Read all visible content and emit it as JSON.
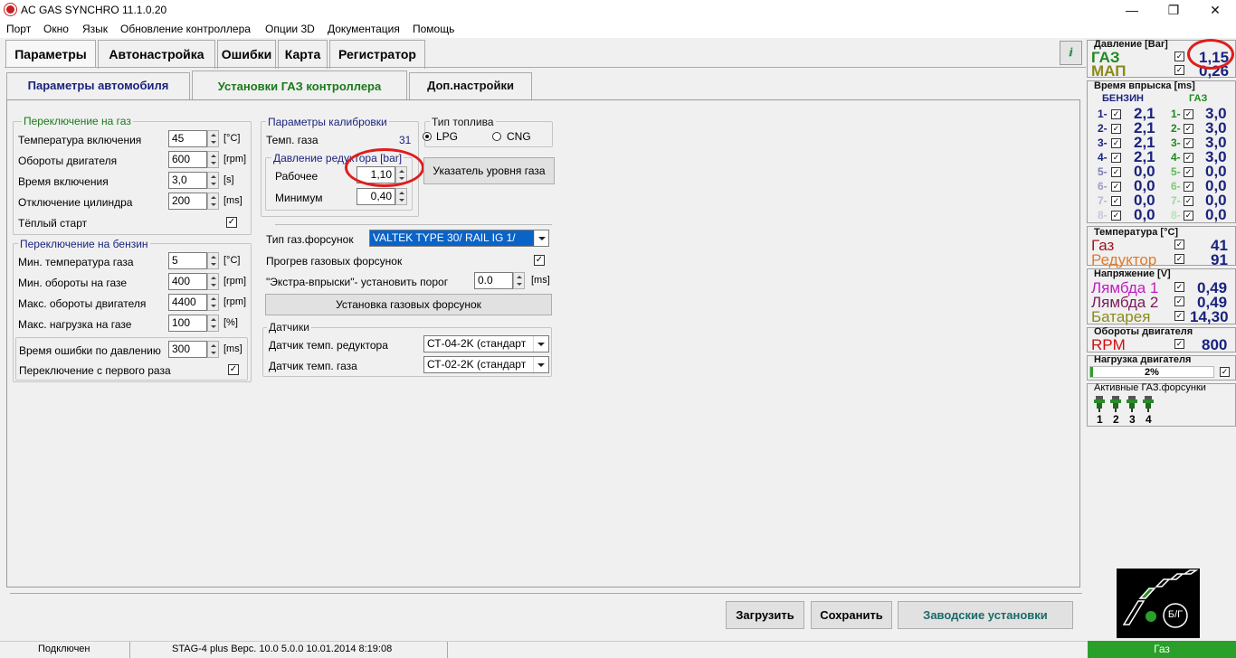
{
  "window": {
    "title": "AC GAS SYNCHRO  11.1.0.20",
    "minimize": "—",
    "maximize": "❐",
    "close": "✕"
  },
  "menu": [
    "Порт",
    "Окно",
    "Язык",
    "Обновление контроллера",
    "Опции 3D",
    "Документация",
    "Помощь"
  ],
  "tabs": [
    "Параметры",
    "Автонастройка",
    "Ошибки",
    "Карта",
    "Регистратор"
  ],
  "subtabs": [
    "Параметры автомобиля",
    "Установки ГАЗ контроллера",
    "Доп.настройки"
  ],
  "switch_gas": {
    "title": "Переключение на газ",
    "rows": [
      {
        "label": "Температура включения",
        "value": "45",
        "unit": "[°C]"
      },
      {
        "label": "Обороты двигателя",
        "value": "600",
        "unit": "[rpm]"
      },
      {
        "label": "Время включения",
        "value": "3,0",
        "unit": "[s]"
      },
      {
        "label": "Отключение цилиндра",
        "value": "200",
        "unit": "[ms]"
      }
    ],
    "warm_start": "Тёплый старт"
  },
  "switch_petrol": {
    "title": "Переключение на бензин",
    "rows": [
      {
        "label": "Мин. температура газа",
        "value": "5",
        "unit": "[°C]"
      },
      {
        "label": "Мин. обороты на газе",
        "value": "400",
        "unit": "[rpm]"
      },
      {
        "label": "Макс. обороты двигателя",
        "value": "4400",
        "unit": "[rpm]"
      },
      {
        "label": "Макс. нагрузка на газе",
        "value": "100",
        "unit": "[%]"
      }
    ],
    "err_time_label": "Время ошибки по давлению",
    "err_time_value": "300",
    "err_time_unit": "[ms]",
    "first_switch": "Переключение с первого раза"
  },
  "calib": {
    "title": "Параметры калибровки",
    "gas_temp_label": "Темп. газа",
    "gas_temp_value": "31",
    "pressure_title": "Давление редуктора [bar]",
    "work_label": "Рабочее",
    "work_value": "1,10",
    "min_label": "Минимум",
    "min_value": "0,40"
  },
  "fuel": {
    "title": "Тип топлива",
    "lpg": "LPG",
    "cng": "CNG"
  },
  "gauge_button": "Указатель уровня газа",
  "injector": {
    "type_label": "Тип газ.форсунок",
    "type_value": "VALTEK TYPE 30/ RAIL IG 1/",
    "heat_label": "Прогрев газовых форсунок",
    "extra_label": "\"Экстра-впрыски\"- установить порог",
    "extra_value": "0.0",
    "extra_unit": "[ms]",
    "setup_button": "Установка газовых форсунок"
  },
  "sensors": {
    "title": "Датчики",
    "reducer_label": "Датчик темп. редуктора",
    "reducer_value": "СТ-04-2K (стандарт",
    "gas_label": "Датчик темп. газа",
    "gas_value": "СТ-02-2K (стандарт"
  },
  "footer": {
    "load": "Загрузить",
    "save": "Сохранить",
    "factory": "Заводские установки"
  },
  "status": {
    "connected": "Подключен",
    "device": "STAG-4 plus   Верс. 10.0  5.0.0    10.01.2014 8:19:08",
    "mode": "Газ"
  },
  "right": {
    "pressure": {
      "title": "Давление [Bar]",
      "gas_label": "ГАЗ",
      "gas_value": "1,15",
      "map_label": "МАП",
      "map_value": "0,26"
    },
    "injection": {
      "title": "Время впрыска [ms]",
      "petrol_header": "БЕНЗИН",
      "gas_header": "ГАЗ",
      "rows": [
        {
          "n": "1-",
          "p": "2,1",
          "g": "3,0"
        },
        {
          "n": "2-",
          "p": "2,1",
          "g": "3,0"
        },
        {
          "n": "3-",
          "p": "2,1",
          "g": "3,0"
        },
        {
          "n": "4-",
          "p": "2,1",
          "g": "3,0"
        },
        {
          "n": "5-",
          "p": "0,0",
          "g": "0,0"
        },
        {
          "n": "6-",
          "p": "0,0",
          "g": "0,0"
        },
        {
          "n": "7-",
          "p": "0,0",
          "g": "0,0"
        },
        {
          "n": "8-",
          "p": "0,0",
          "g": "0,0"
        }
      ]
    },
    "temperature": {
      "title": "Температура  [°C]",
      "gas_label": "Газ",
      "gas_value": "41",
      "reducer_label": "Редуктор",
      "reducer_value": "91"
    },
    "voltage": {
      "title": "Напряжение [V]",
      "l1_label": "Лямбда 1",
      "l1_value": "0,49",
      "l2_label": "Лямбда 2",
      "l2_value": "0,49",
      "bat_label": "Батарея",
      "bat_value": "14,30"
    },
    "rpm": {
      "title": "Обороты двигателя",
      "label": "RPM",
      "value": "800"
    },
    "load": {
      "title": "Нагрузка двигателя",
      "value": "2%",
      "fraction": 0.02
    },
    "active": {
      "title": "Активные ГАЗ.форсунки",
      "nums": [
        "1",
        "2",
        "3",
        "4"
      ]
    },
    "switch_logo": "Б/Г"
  },
  "colors": {
    "green": "#1f8a1f",
    "darkblue": "#1a237e",
    "orange": "#e07b2c",
    "magenta": "#c21cc2",
    "purple": "#7a1a5c",
    "olive": "#8a8a1a",
    "red": "#d01010",
    "status_green": "#2aa02a"
  }
}
